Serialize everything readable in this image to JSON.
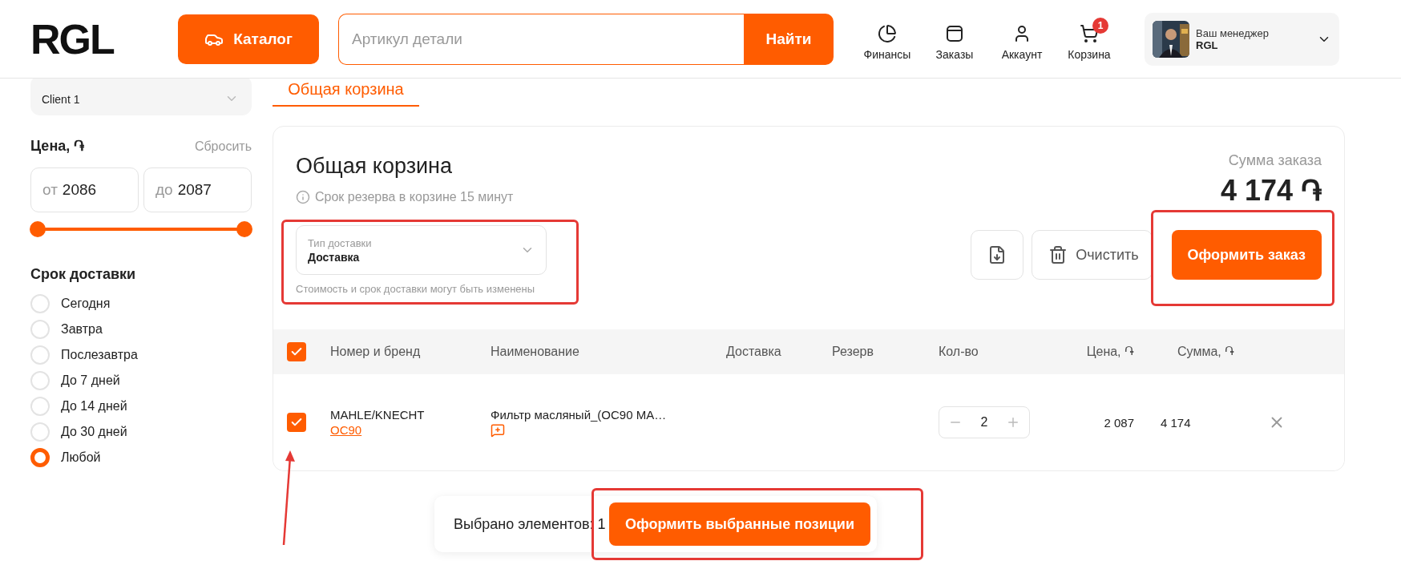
{
  "header": {
    "logo": "RGL",
    "catalog_button": "Каталог",
    "search": {
      "placeholder": "Артикул детали"
    },
    "search_button": "Найти",
    "nav": [
      {
        "kind": "finance",
        "label": "Финансы"
      },
      {
        "kind": "orders",
        "label": "Заказы"
      },
      {
        "kind": "account",
        "label": "Аккаунт"
      },
      {
        "kind": "cart",
        "label": "Корзина",
        "badge": "1"
      }
    ],
    "manager": {
      "title": "Ваш менеджер",
      "name": "RGL"
    }
  },
  "sidebar": {
    "client": "Client 1",
    "price": {
      "title": "Цена, ֏",
      "reset": "Сбросить",
      "from_prefix": "от",
      "from": "2086",
      "to_prefix": "до",
      "to": "2087",
      "thumbs": [
        {
          "level": 0
        },
        {
          "level": 1
        }
      ]
    },
    "delivery_title": "Срок доставки",
    "delivery_options": [
      {
        "label": "Сегодня",
        "selected": false
      },
      {
        "label": "Завтра",
        "selected": false
      },
      {
        "label": "Послезавтра",
        "selected": false
      },
      {
        "label": "До 7 дней",
        "selected": false
      },
      {
        "label": "До 14 дней",
        "selected": false
      },
      {
        "label": "До 30 дней",
        "selected": false
      },
      {
        "label": "Любой",
        "selected": true
      }
    ]
  },
  "tabs": [
    {
      "label": "Общая корзина",
      "selected": true
    }
  ],
  "cart": {
    "title": "Общая корзина",
    "note": "Срок резерва в корзине 15 минут",
    "sum_label": "Сумма заказа",
    "sum": "4 174 ֏",
    "delivery": {
      "label": "Тип доставки",
      "value": "Доставка",
      "hint": "Стоимость и срок доставки могут быть изменены",
      "highlighted": true
    },
    "clear_button": "Очистить",
    "order_button": {
      "label": "Оформить заказ",
      "highlighted": true
    },
    "table": {
      "select_all": {
        "checked": true
      },
      "columns": [
        "Номер и бренд",
        "Наименование",
        "Доставка",
        "Резерв",
        "Кол-во",
        "Цена, ֏",
        "Сумма, ֏"
      ],
      "rows": [
        {
          "checked": true,
          "pointed": true,
          "brand": "MAHLE/KNECHT",
          "article": "OC90",
          "name": "Фильтр масляный_(OC90 MA…",
          "quantity": "2",
          "price": "2 087",
          "sum": "4 174"
        }
      ]
    }
  },
  "selection_bar": {
    "text": "Выбрано элементов: 1",
    "button": "Оформить выбранные позиции",
    "highlighted": true
  }
}
